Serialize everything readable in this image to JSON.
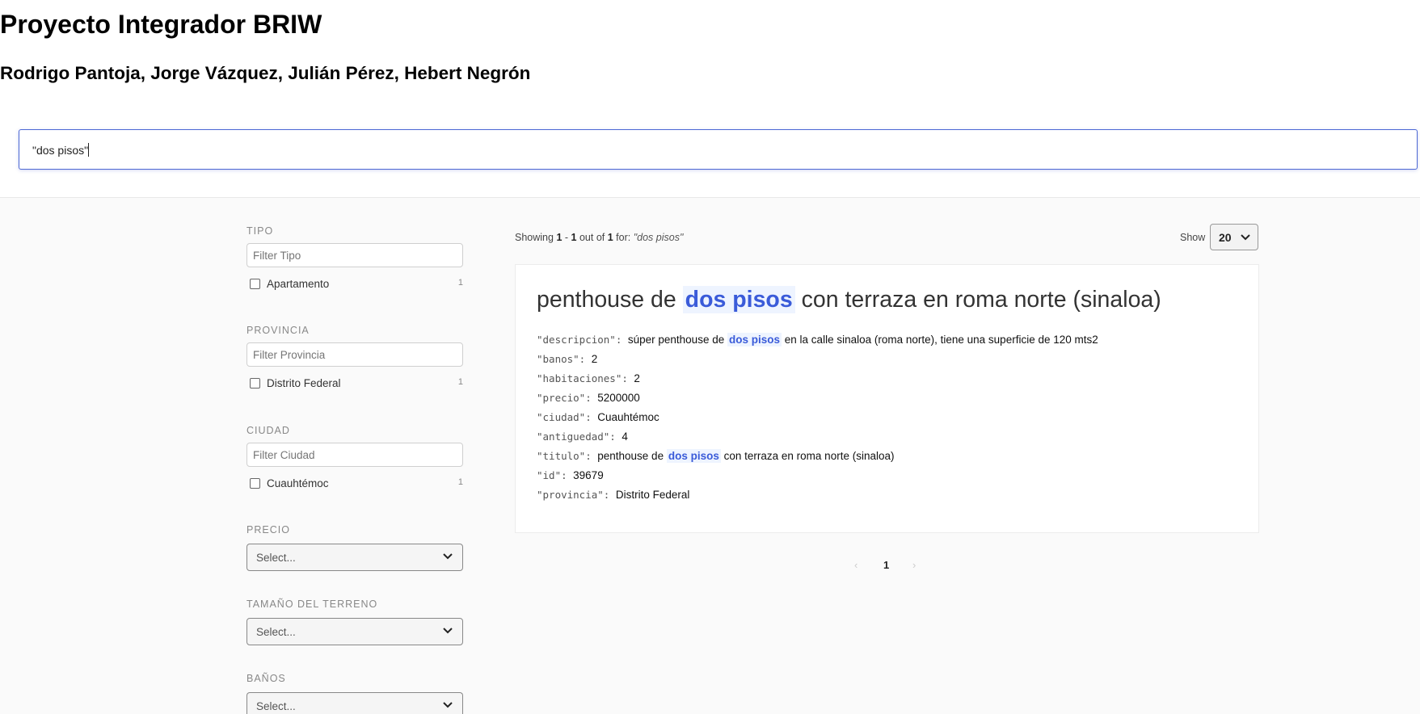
{
  "header": {
    "title": "Proyecto Integrador BRIW",
    "authors": "Rodrigo Pantoja, Jorge Vázquez, Julián Pérez, Hebert Negrón"
  },
  "search": {
    "value": "\"dos pisos\""
  },
  "facets": {
    "tipo": {
      "label": "TIPO",
      "placeholder": "Filter Tipo",
      "option": "Apartamento",
      "count": "1"
    },
    "provincia": {
      "label": "PROVINCIA",
      "placeholder": "Filter Provincia",
      "option": "Distrito Federal",
      "count": "1"
    },
    "ciudad": {
      "label": "CIUDAD",
      "placeholder": "Filter Ciudad",
      "option": "Cuauhtémoc",
      "count": "1"
    },
    "precio": {
      "label": "PRECIO",
      "select": "Select..."
    },
    "terreno": {
      "label": "TAMAÑO DEL TERRENO",
      "select": "Select..."
    },
    "banos": {
      "label": "BAÑOS",
      "select": "Select..."
    }
  },
  "results_info": {
    "showing": "Showing",
    "start": "1",
    "dash": "-",
    "end": "1",
    "out_of": "out of",
    "total": "1",
    "for": "for:",
    "query": "\"dos pisos\""
  },
  "page_size": {
    "label": "Show",
    "value": "20"
  },
  "result": {
    "title_before": "penthouse de",
    "title_highlight": "dos pisos",
    "title_after": "con terraza en roma norte (sinaloa)",
    "fields": {
      "descripcion": {
        "key": "\"descripcion\":",
        "before": "súper penthouse de",
        "highlight": "dos pisos",
        "after": "en la calle sinaloa (roma norte), tiene una superficie de 120 mts2"
      },
      "banos": {
        "key": "\"banos\":",
        "value": "2"
      },
      "habitaciones": {
        "key": "\"habitaciones\":",
        "value": "2"
      },
      "precio": {
        "key": "\"precio\":",
        "value": "5200000"
      },
      "ciudad": {
        "key": "\"ciudad\":",
        "value": "Cuauhtémoc"
      },
      "antiguedad": {
        "key": "\"antiguedad\":",
        "value": "4"
      },
      "titulo": {
        "key": "\"titulo\":",
        "before": "penthouse de",
        "highlight": "dos pisos",
        "after": "con terraza en roma norte (sinaloa)"
      },
      "id": {
        "key": "\"id\":",
        "value": "39679"
      },
      "provincia": {
        "key": "\"provincia\":",
        "value": "Distrito Federal"
      }
    }
  },
  "pagination": {
    "prev": "‹",
    "current": "1",
    "next": "›"
  }
}
